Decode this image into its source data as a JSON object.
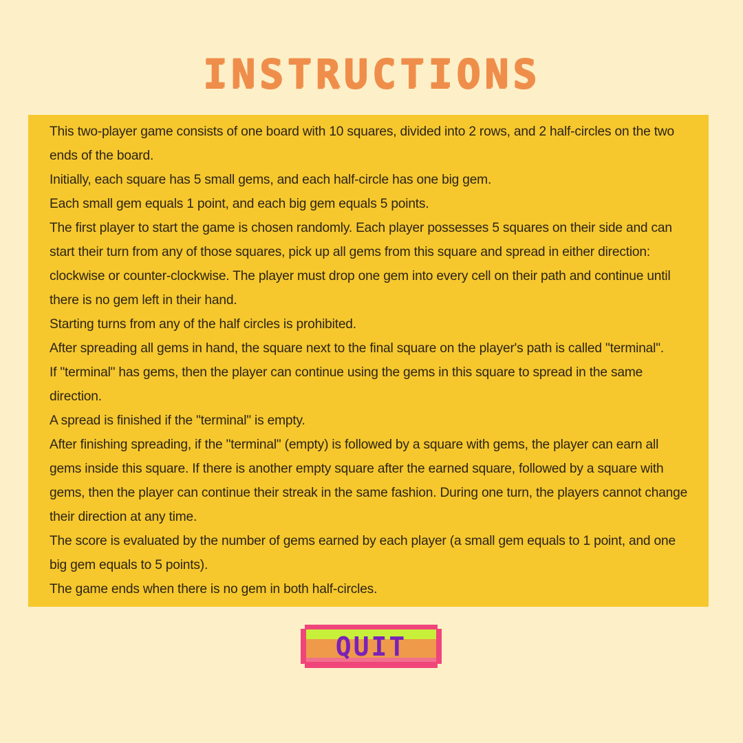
{
  "screen": {
    "title": "INSTRUCTIONS"
  },
  "instructions": [
    "This two-player game consists of one board with 10 squares, divided into 2 rows, and 2 half-circles on the two ends of the board.",
    "Initially, each square has 5 small gems, and each half-circle has one big gem.",
    "Each small gem equals 1 point, and each big gem equals 5 points.",
    "The first player to start the game is chosen randomly. Each player possesses 5 squares on their side and can start their turn from any of those squares, pick up all gems from this square and spread in either direction: clockwise or counter-clockwise. The player must drop one gem into every cell on their path and continue until there is no gem left in their hand.",
    "Starting turns from any of the half circles is prohibited.",
    "After spreading all gems in hand, the square next to the final square on the player's path is called \"terminal\".",
    "If \"terminal\" has gems, then the player can continue using the gems in this square to spread in the same direction.",
    "A spread is finished if the \"terminal\" is empty.",
    "After finishing spreading, if the \"terminal\" (empty) is followed by a square with gems, the player can earn all gems inside this square. If there is another empty square after the earned square, followed by a square with gems, then the player can continue their streak in the same fashion. During one turn, the players cannot change their direction at any time.",
    "The score is evaluated by the number of gems earned by each player (a small gem equals to 1 point, and one big gem equals to 5 points).",
    "The game ends when there is no gem in both half-circles."
  ],
  "buttons": {
    "quit_label": "QUIT"
  },
  "colors": {
    "background": "#fdf0c8",
    "title": "#ef8e4b",
    "panel": "#f6c82e",
    "quit_text": "#7a21b8",
    "quit_border": "#f0457a",
    "quit_highlight": "#c8f03a",
    "quit_fill": "#ee9a4a"
  }
}
